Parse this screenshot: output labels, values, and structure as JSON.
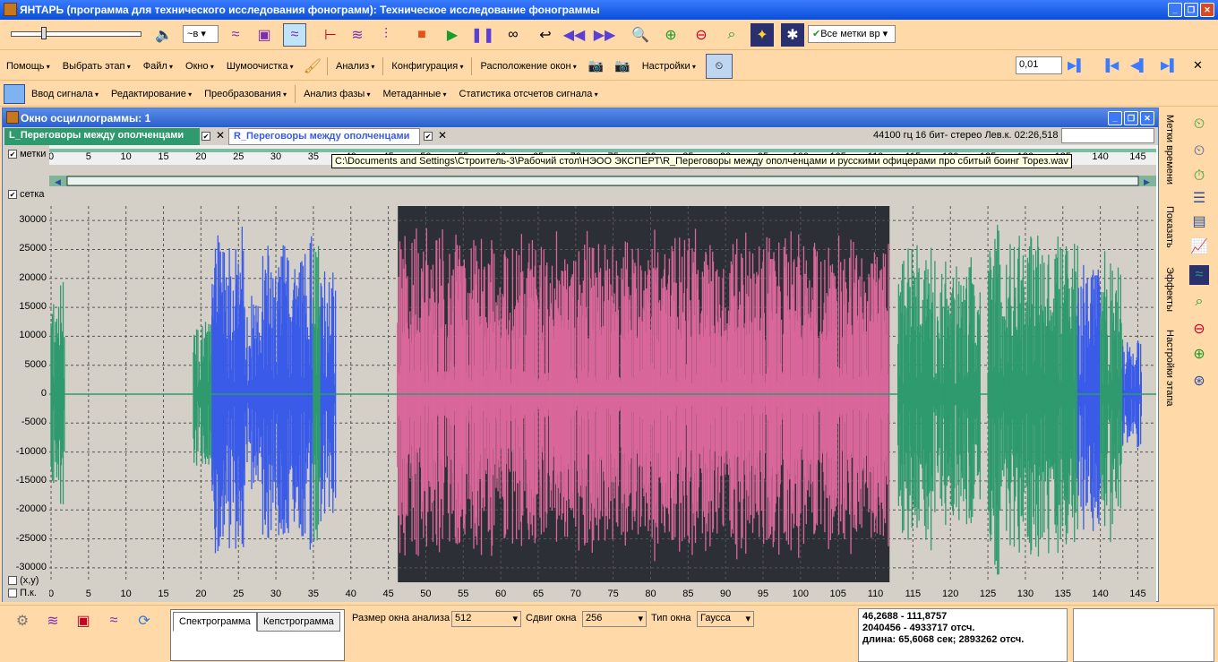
{
  "window": {
    "title": "ЯНТАРЬ (программа для технического исследования фонограмм): Техническое исследование фонограммы"
  },
  "toolbar": {
    "channel_combo": "в",
    "marks_combo": "Все метки вр"
  },
  "menu1": [
    "Помощь",
    "Выбрать этап",
    "Файл",
    "Окно",
    "Шумоочистка",
    "Анализ",
    "Конфигурация",
    "Расположение окон",
    "Настройки"
  ],
  "menu1_value": "0,01",
  "menu2": [
    "Ввод сигнала",
    "Редактирование",
    "Преобразования",
    "Анализ фазы",
    "Метаданные",
    "Статистика отсчетов сигнала"
  ],
  "osc": {
    "title": "Окно осциллограммы: 1",
    "tab_left": "L_Переговоры между ополченцами",
    "tab_right": "R_Переговоры между ополченцами",
    "format_info": "44100 гц 16 бит- стерео Лев.к. 02:26,518",
    "chk_marks": "метки",
    "chk_grid": "сетка",
    "chk_xy": "(x,y)",
    "chk_pk": "П.к.",
    "tooltip": "C:\\Documents and Settings\\Строитель-3\\Рабочий стол\\НЭОО ЭКСПЕРТ\\R_Переговоры между ополченцами и русскими офицерами про сбитый боинг Торез.wav"
  },
  "chart_data": {
    "type": "waveform",
    "x_ticks": [
      0,
      5,
      10,
      15,
      20,
      25,
      30,
      35,
      40,
      45,
      50,
      55,
      60,
      65,
      70,
      75,
      80,
      85,
      90,
      95,
      100,
      105,
      110,
      115,
      120,
      125,
      130,
      135,
      140,
      145
    ],
    "y_ticks": [
      30000,
      25000,
      20000,
      15000,
      10000,
      5000,
      0,
      -5000,
      -10000,
      -15000,
      -20000,
      -25000,
      -30000
    ],
    "xlim": [
      0,
      146.5
    ],
    "ylim": [
      -32500,
      32500
    ],
    "selection": [
      46.2688,
      111.8757
    ],
    "colors": {
      "left": "#2e9a6e",
      "right": "#3a5ae8",
      "selected": "#d9679a",
      "sel_bg": "#2c2f36",
      "bg": "#d4d0c8"
    }
  },
  "bottom": {
    "tab_spectro": "Спектрограмма",
    "tab_cepstro": "Кепстрограмма",
    "win_size_label": "Размер окна анализа",
    "win_size_value": "512",
    "shift_label": "Сдвиг окна",
    "shift_value": "256",
    "type_label": "Тип окна",
    "type_value": "Гаусса",
    "sel_time": "46,2688 - 111,8757",
    "sel_samples": "2040456 - 4933717 отсч.",
    "sel_length": "длина: 65,6068 сек; 2893262 отсч."
  },
  "sidebar": {
    "labels": [
      "Метки времени",
      "Показать",
      "Эффекты",
      "Настройки этапа"
    ]
  }
}
